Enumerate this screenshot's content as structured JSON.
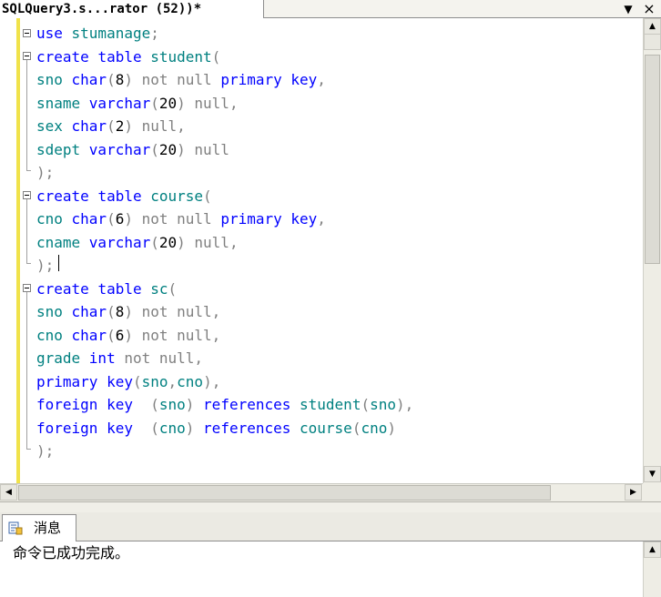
{
  "document_tab": {
    "title": "SQLQuery3.s...rator (52))*",
    "dropdown_glyph": "▼",
    "close_glyph": "×"
  },
  "editor": {
    "lines": [
      [
        {
          "t": "use ",
          "c": "kw"
        },
        {
          "t": "stumanage",
          "c": "id"
        },
        {
          "t": ";",
          "c": "gray"
        }
      ],
      [
        {
          "t": "create ",
          "c": "kw"
        },
        {
          "t": "table ",
          "c": "kw"
        },
        {
          "t": "student",
          "c": "id"
        },
        {
          "t": "(",
          "c": "gray"
        }
      ],
      [
        {
          "t": "sno ",
          "c": "id"
        },
        {
          "t": "char",
          "c": "kw"
        },
        {
          "t": "(",
          "c": "gray"
        },
        {
          "t": "8",
          "c": "num"
        },
        {
          "t": ") not null ",
          "c": "gray"
        },
        {
          "t": "primary key",
          "c": "kw"
        },
        {
          "t": ",",
          "c": "gray"
        }
      ],
      [
        {
          "t": "sname ",
          "c": "id"
        },
        {
          "t": "varchar",
          "c": "kw"
        },
        {
          "t": "(",
          "c": "gray"
        },
        {
          "t": "20",
          "c": "num"
        },
        {
          "t": ") null,",
          "c": "gray"
        }
      ],
      [
        {
          "t": "sex ",
          "c": "id"
        },
        {
          "t": "char",
          "c": "kw"
        },
        {
          "t": "(",
          "c": "gray"
        },
        {
          "t": "2",
          "c": "num"
        },
        {
          "t": ") null,",
          "c": "gray"
        }
      ],
      [
        {
          "t": "sdept ",
          "c": "id"
        },
        {
          "t": "varchar",
          "c": "kw"
        },
        {
          "t": "(",
          "c": "gray"
        },
        {
          "t": "20",
          "c": "num"
        },
        {
          "t": ") null",
          "c": "gray"
        }
      ],
      [
        {
          "t": ");",
          "c": "gray"
        }
      ],
      [
        {
          "t": "create ",
          "c": "kw"
        },
        {
          "t": "table ",
          "c": "kw"
        },
        {
          "t": "course",
          "c": "id"
        },
        {
          "t": "(",
          "c": "gray"
        }
      ],
      [
        {
          "t": "cno ",
          "c": "id"
        },
        {
          "t": "char",
          "c": "kw"
        },
        {
          "t": "(",
          "c": "gray"
        },
        {
          "t": "6",
          "c": "num"
        },
        {
          "t": ") not null ",
          "c": "gray"
        },
        {
          "t": "primary key",
          "c": "kw"
        },
        {
          "t": ",",
          "c": "gray"
        }
      ],
      [
        {
          "t": "cname ",
          "c": "id"
        },
        {
          "t": "varchar",
          "c": "kw"
        },
        {
          "t": "(",
          "c": "gray"
        },
        {
          "t": "20",
          "c": "num"
        },
        {
          "t": ") null,",
          "c": "gray"
        }
      ],
      [
        {
          "t": ");",
          "c": "gray"
        }
      ],
      [
        {
          "t": "create ",
          "c": "kw"
        },
        {
          "t": "table ",
          "c": "kw"
        },
        {
          "t": "sc",
          "c": "id"
        },
        {
          "t": "(",
          "c": "gray"
        }
      ],
      [
        {
          "t": "sno ",
          "c": "id"
        },
        {
          "t": "char",
          "c": "kw"
        },
        {
          "t": "(",
          "c": "gray"
        },
        {
          "t": "8",
          "c": "num"
        },
        {
          "t": ") not null,",
          "c": "gray"
        }
      ],
      [
        {
          "t": "cno ",
          "c": "id"
        },
        {
          "t": "char",
          "c": "kw"
        },
        {
          "t": "(",
          "c": "gray"
        },
        {
          "t": "6",
          "c": "num"
        },
        {
          "t": ") not null,",
          "c": "gray"
        }
      ],
      [
        {
          "t": "grade ",
          "c": "id"
        },
        {
          "t": "int ",
          "c": "kw"
        },
        {
          "t": "not null,",
          "c": "gray"
        }
      ],
      [
        {
          "t": "primary key",
          "c": "kw"
        },
        {
          "t": "(",
          "c": "gray"
        },
        {
          "t": "sno",
          "c": "id"
        },
        {
          "t": ",",
          "c": "gray"
        },
        {
          "t": "cno",
          "c": "id"
        },
        {
          "t": "),",
          "c": "gray"
        }
      ],
      [
        {
          "t": "foreign key  ",
          "c": "kw"
        },
        {
          "t": "(",
          "c": "gray"
        },
        {
          "t": "sno",
          "c": "id"
        },
        {
          "t": ") ",
          "c": "gray"
        },
        {
          "t": "references ",
          "c": "kw"
        },
        {
          "t": "student",
          "c": "id"
        },
        {
          "t": "(",
          "c": "gray"
        },
        {
          "t": "sno",
          "c": "id"
        },
        {
          "t": "),",
          "c": "gray"
        }
      ],
      [
        {
          "t": "foreign key  ",
          "c": "kw"
        },
        {
          "t": "(",
          "c": "gray"
        },
        {
          "t": "cno",
          "c": "id"
        },
        {
          "t": ") ",
          "c": "gray"
        },
        {
          "t": "references ",
          "c": "kw"
        },
        {
          "t": "course",
          "c": "id"
        },
        {
          "t": "(",
          "c": "gray"
        },
        {
          "t": "cno",
          "c": "id"
        },
        {
          "t": ")",
          "c": "gray"
        }
      ],
      [
        {
          "t": ");",
          "c": "gray"
        }
      ]
    ],
    "colors": {
      "keyword": "#0000ff",
      "identifier": "#008080",
      "punctuation": "#808080",
      "change_bar": "#f0e24a"
    }
  },
  "results": {
    "tab_label": "消息",
    "tab_icon": "messages-icon",
    "message": "命令已成功完成。"
  },
  "scrollbar": {
    "up": "▲",
    "down": "▼",
    "left": "◀",
    "right": "▶"
  }
}
